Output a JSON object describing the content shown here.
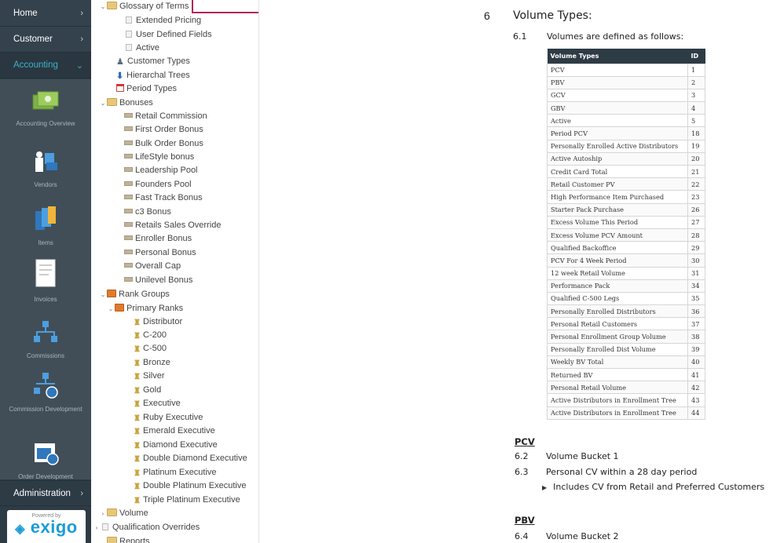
{
  "leftnav": {
    "home": "Home",
    "customer": "Customer",
    "accounting": "Accounting",
    "administration": "Administration",
    "accounting_items": [
      {
        "label": "Accounting Overview",
        "icon": "money-icon"
      },
      {
        "label": "Vendors",
        "icon": "vendors-icon"
      },
      {
        "label": "Items",
        "icon": "items-icon"
      },
      {
        "label": "Invoices",
        "icon": "invoice-icon"
      },
      {
        "label": "Commissions",
        "icon": "commissions-icon"
      },
      {
        "label": "Commission Development",
        "icon": "commission-development-icon"
      },
      {
        "label": "Order Development",
        "icon": "order-development-icon"
      }
    ],
    "powered_by": "Powered by",
    "brand": "exigo"
  },
  "tree": {
    "items": [
      {
        "label": "Glossary of Terms",
        "icon": "folder-open-icon",
        "expander": "⌄"
      },
      {
        "label": "Extended Pricing",
        "icon": "page-icon",
        "expander": ""
      },
      {
        "label": "User Defined Fields",
        "icon": "page-icon",
        "expander": ""
      },
      {
        "label": "Active",
        "icon": "page-icon",
        "expander": ""
      },
      {
        "label": "Customer Types",
        "icon": "user-icon",
        "expander": ""
      },
      {
        "label": "Hierarchal Trees",
        "icon": "arrow-icon",
        "expander": ""
      },
      {
        "label": "Period Types",
        "icon": "calendar-icon",
        "expander": ""
      },
      {
        "label": "Bonuses",
        "icon": "folder-icon",
        "expander": "⌄"
      },
      {
        "label": "Retail Commission",
        "icon": "bonus-icon",
        "expander": ""
      },
      {
        "label": "First Order Bonus",
        "icon": "bonus-icon",
        "expander": ""
      },
      {
        "label": "Bulk Order Bonus",
        "icon": "bonus-icon",
        "expander": ""
      },
      {
        "label": "LifeStyle bonus",
        "icon": "bonus-icon",
        "expander": ""
      },
      {
        "label": "Leadership Pool",
        "icon": "bonus-icon",
        "expander": ""
      },
      {
        "label": "Founders Pool",
        "icon": "bonus-icon",
        "expander": ""
      },
      {
        "label": "Fast Track Bonus",
        "icon": "bonus-icon",
        "expander": ""
      },
      {
        "label": "c3 Bonus",
        "icon": "bonus-icon",
        "expander": ""
      },
      {
        "label": "Retails Sales Override",
        "icon": "bonus-icon",
        "expander": ""
      },
      {
        "label": "Enroller Bonus",
        "icon": "bonus-icon",
        "expander": ""
      },
      {
        "label": "Personal Bonus",
        "icon": "bonus-icon",
        "expander": ""
      },
      {
        "label": "Overall Cap",
        "icon": "bonus-icon",
        "expander": ""
      },
      {
        "label": "Unilevel Bonus",
        "icon": "bonus-icon",
        "expander": ""
      },
      {
        "label": "Rank Groups",
        "icon": "rank-folder-icon",
        "expander": "⌄"
      },
      {
        "label": "Primary Ranks",
        "icon": "rank-folder-icon",
        "expander": "⌄"
      },
      {
        "label": "Distributor",
        "icon": "rank-icon",
        "expander": ""
      },
      {
        "label": "C-200",
        "icon": "rank-icon",
        "expander": ""
      },
      {
        "label": "C-500",
        "icon": "rank-icon",
        "expander": ""
      },
      {
        "label": "Bronze",
        "icon": "rank-icon",
        "expander": ""
      },
      {
        "label": "Silver",
        "icon": "rank-icon",
        "expander": ""
      },
      {
        "label": "Gold",
        "icon": "rank-icon",
        "expander": ""
      },
      {
        "label": "Executive",
        "icon": "rank-icon",
        "expander": ""
      },
      {
        "label": "Ruby Executive",
        "icon": "rank-icon",
        "expander": ""
      },
      {
        "label": "Emerald Executive",
        "icon": "rank-icon",
        "expander": ""
      },
      {
        "label": "Diamond Executive",
        "icon": "rank-icon",
        "expander": ""
      },
      {
        "label": "Double Diamond Executive",
        "icon": "rank-icon",
        "expander": ""
      },
      {
        "label": "Platinum Executive",
        "icon": "rank-icon",
        "expander": ""
      },
      {
        "label": "Double Platinum Executive",
        "icon": "rank-icon",
        "expander": ""
      },
      {
        "label": "Triple Platinum Executive",
        "icon": "rank-icon",
        "expander": ""
      },
      {
        "label": "Volume",
        "icon": "folder-icon",
        "expander": "›"
      },
      {
        "label": "Qualification Overrides",
        "icon": "page-icon",
        "expander": "›"
      },
      {
        "label": "Reports",
        "icon": "folder-icon",
        "expander": ""
      }
    ]
  },
  "content": {
    "section_number": "6",
    "section_title": "Volume Types:",
    "sub_6_1_num": "6.1",
    "sub_6_1_text": "Volumes are defined as follows:",
    "table": {
      "headers": [
        "Volume Types",
        "ID"
      ],
      "rows": [
        [
          "PCV",
          "1"
        ],
        [
          "PBV",
          "2"
        ],
        [
          "GCV",
          "3"
        ],
        [
          "GBV",
          "4"
        ],
        [
          "Active",
          "5"
        ],
        [
          "Period PCV",
          "18"
        ],
        [
          "Personally Enrolled Active Distributors",
          "19"
        ],
        [
          "Active Autoship",
          "20"
        ],
        [
          "Credit Card Total",
          "21"
        ],
        [
          "Retail Customer PV",
          "22"
        ],
        [
          "High Performance Item Purchased",
          "23"
        ],
        [
          "Starter Pack Purchase",
          "26"
        ],
        [
          "Excess Volume This Period",
          "27"
        ],
        [
          "Excess Volume PCV Amount",
          "28"
        ],
        [
          "Qualified Backoffice",
          "29"
        ],
        [
          "PCV For 4 Week Period",
          "30"
        ],
        [
          "12 week Retail Volume",
          "31"
        ],
        [
          "Performance Pack",
          "34"
        ],
        [
          "Qualified C-500 Legs",
          "35"
        ],
        [
          "Personally Enrolled Distributors",
          "36"
        ],
        [
          "Personal Retail Customers",
          "37"
        ],
        [
          "Personal Enrollment Group Volume",
          "38"
        ],
        [
          "Personally Enrolled Dist Volume",
          "39"
        ],
        [
          "Weekly BV Total",
          "40"
        ],
        [
          "Returned BV",
          "41"
        ],
        [
          "Personal Retail Volume",
          "42"
        ],
        [
          "Active Distributors in Enrollment Tree",
          "43"
        ],
        [
          "Active Distributors in Enrollment Tree",
          "44"
        ]
      ]
    },
    "pcv_heading": "PCV",
    "sub_6_2_num": "6.2",
    "sub_6_2_text": "Volume Bucket 1",
    "sub_6_3_num": "6.3",
    "sub_6_3_text": "Personal CV within a 28 day period",
    "bullet_text": "Includes CV from Retail and Preferred Customers",
    "pbv_heading": "PBV",
    "sub_6_4_num": "6.4",
    "sub_6_4_text": "Volume Bucket 2"
  },
  "colors": {
    "nav_bg": "#2d3b45",
    "accent": "#3ab3c9",
    "highlight_border": "#b0245a",
    "brand_blue": "#1c9bd7"
  }
}
